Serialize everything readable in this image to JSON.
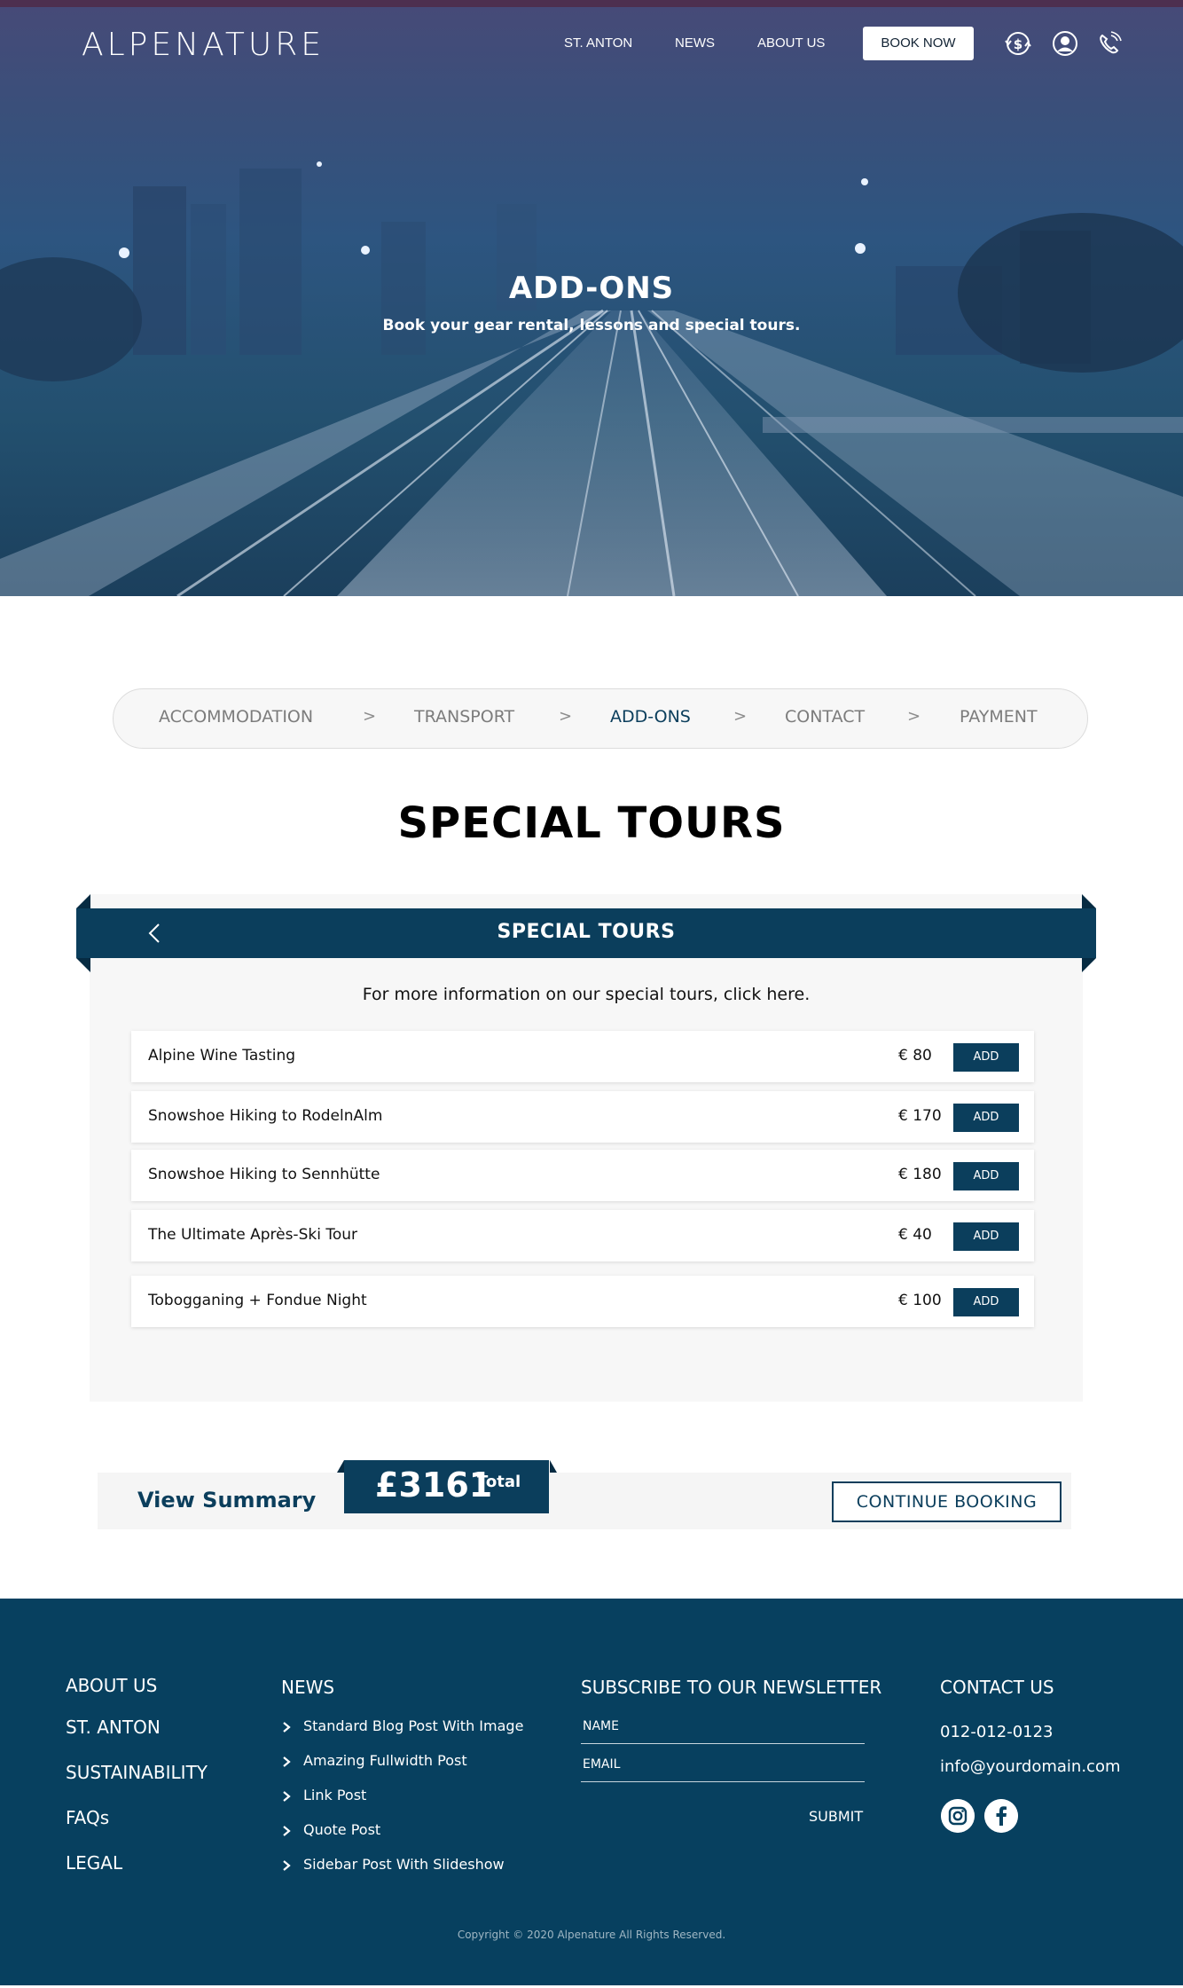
{
  "brand": {
    "logo": "ALPENATURE"
  },
  "nav": {
    "links": [
      "ST. ANTON",
      "NEWS",
      "ABOUT US"
    ],
    "book_now": "BOOK NOW",
    "icons": [
      "currency-exchange-icon",
      "user-icon",
      "phone-icon"
    ]
  },
  "hero": {
    "title": "ADD-ONS",
    "subtitle": "Book your gear rental, lessons and special tours."
  },
  "steps": {
    "items": [
      "ACCOMMODATION",
      "TRANSPORT",
      "ADD-ONS",
      "CONTACT",
      "PAYMENT"
    ],
    "separator": ">",
    "active": "ADD-ONS"
  },
  "section": {
    "title": "SPECIAL TOURS"
  },
  "panel": {
    "title": "SPECIAL TOURS",
    "info": "For more information on our special tours, click here.",
    "add_label": "ADD",
    "tours": [
      {
        "name": "Alpine Wine Tasting",
        "price": "€ 80"
      },
      {
        "name": "Snowshoe Hiking to RodelnAlm",
        "price": "€ 170"
      },
      {
        "name": "Snowshoe Hiking to Sennhütte",
        "price": "€ 180"
      },
      {
        "name": "The Ultimate Après-Ski Tour",
        "price": "€ 40"
      },
      {
        "name": "Tobogganing + Fondue Night",
        "price": "€ 100"
      }
    ]
  },
  "summary": {
    "view_summary": "View Summary",
    "total_amount": "£3161",
    "total_label": "Total",
    "continue": "CONTINUE BOOKING"
  },
  "footer": {
    "col1": [
      "ABOUT US",
      "ST. ANTON",
      "SUSTAINABILITY",
      "FAQs",
      "LEGAL"
    ],
    "news_title": "NEWS",
    "news": [
      "Standard Blog Post With Image",
      "Amazing Fullwidth Post",
      "Link Post",
      "Quote Post",
      "Sidebar Post With Slideshow"
    ],
    "newsletter_title": "SUBSCRIBE TO OUR NEWSLETTER",
    "name_label": "NAME",
    "email_label": "EMAIL",
    "submit": "SUBMIT",
    "contact_title": "CONTACT US",
    "phone": "012-012-0123",
    "email": "info@yourdomain.com",
    "social_icons": [
      "instagram-icon",
      "facebook-icon"
    ],
    "copyright": "Copyright © 2020  Alpenature  All Rights Reserved."
  },
  "colors": {
    "primary": "#0b3e5c",
    "footer": "#07405f",
    "panel": "#f7f7f7"
  }
}
